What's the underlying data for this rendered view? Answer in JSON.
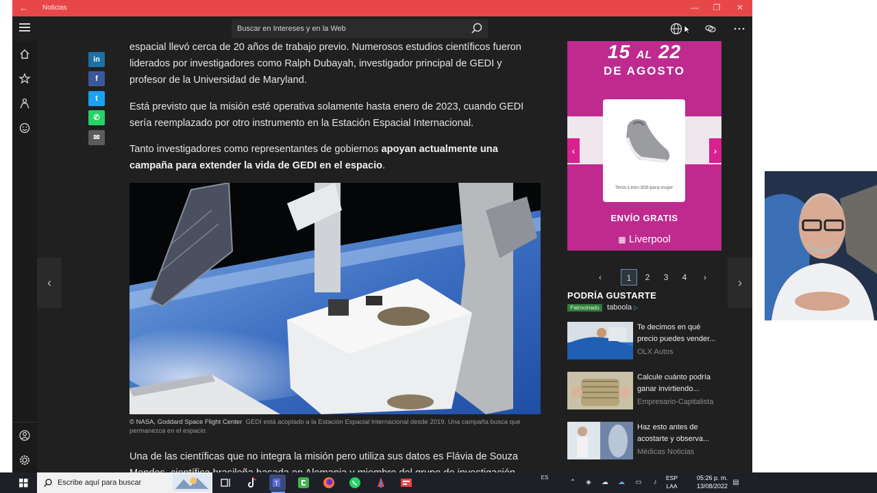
{
  "window": {
    "title": "Noticias",
    "back_glyph": "←",
    "controls": [
      "—",
      "❐",
      "✕"
    ]
  },
  "topbar": {
    "search_placeholder": "Buscar en Intereses y en la Web",
    "icons": [
      "globe-icon",
      "chat-bubbles-icon",
      "more-icon"
    ]
  },
  "leftnav": {
    "items": [
      "home-icon",
      "favorites-icon",
      "interests-icon",
      "emoji-icon"
    ],
    "bottom": [
      "account-icon",
      "settings-icon"
    ]
  },
  "share_buttons": [
    {
      "name": "linkedin",
      "label": "in",
      "color": "#1d6fa5"
    },
    {
      "name": "facebook",
      "label": "f",
      "color": "#3b5998"
    },
    {
      "name": "twitter",
      "label": "t",
      "color": "#1da1f2"
    },
    {
      "name": "whatsapp",
      "label": "✆",
      "color": "#25d366"
    },
    {
      "name": "email",
      "label": "✉",
      "color": "#5c5c5c"
    }
  ],
  "article": {
    "p1": "espacial llevó cerca de 20 años de trabajo previo. Numerosos estudios científicos fueron liderados por investigadores como Ralph Dubayah, investigador principal de GEDI y profesor de la Universidad de Maryland.",
    "p2": "Está previsto que la misión esté operativa solamente hasta enero de 2023, cuando GEDI sería reemplazado por otro instrumento en la Estación Espacial Internacional.",
    "p3_plain": "Tanto investigadores como representantes de gobiernos ",
    "p3_bold": "apoyan actualmente una campaña para extender la vida de GEDI en el espacio",
    "p3_end": ".",
    "caption_credit": "© NASA, Goddard Space Flight Center",
    "caption_text": "GEDI está acoplado a la Estación Espacial Internacional desde 2019. Una campaña busca que permanezca en el espacio.",
    "p4": "Una de las científicas que no integra la misión pero utiliza sus datos es Flávia de Souza Mendes, científica brasileña basada en Alemania y miembro del grupo de investigación"
  },
  "ad": {
    "dates_from": "15",
    "dates_al": "AL",
    "dates_to": "22",
    "month": "DE AGOSTO",
    "product": "Tenis-Leon-309-para-mujer",
    "shipping": "ENVÍO GRATIS",
    "brand": "Liverpool"
  },
  "pager": {
    "prev": "‹",
    "pages": [
      "1",
      "2",
      "3",
      "4"
    ],
    "next": "›",
    "active": "1"
  },
  "recommendations": {
    "heading": "PODRÍA GUSTARTE",
    "sponsored": "Patrocinado",
    "provider": "taboola",
    "items": [
      {
        "title": "Te decimos en qué precio puedes vender...",
        "source": "OLX Autos"
      },
      {
        "title": "Calcule cuánto podría ganar invirtiendo...",
        "source": "Empresario-Capitalista"
      },
      {
        "title": "Haz esto antes de acostarte y observa...",
        "source": "Médicas Noticias"
      }
    ]
  },
  "taskbar": {
    "search_placeholder": "Escribe aquí para buscar",
    "lang_top": "ESP",
    "lang_bottom": "LAA",
    "lang_short": "ES",
    "time": "05:26 p. m.",
    "date": "13/08/2022"
  }
}
